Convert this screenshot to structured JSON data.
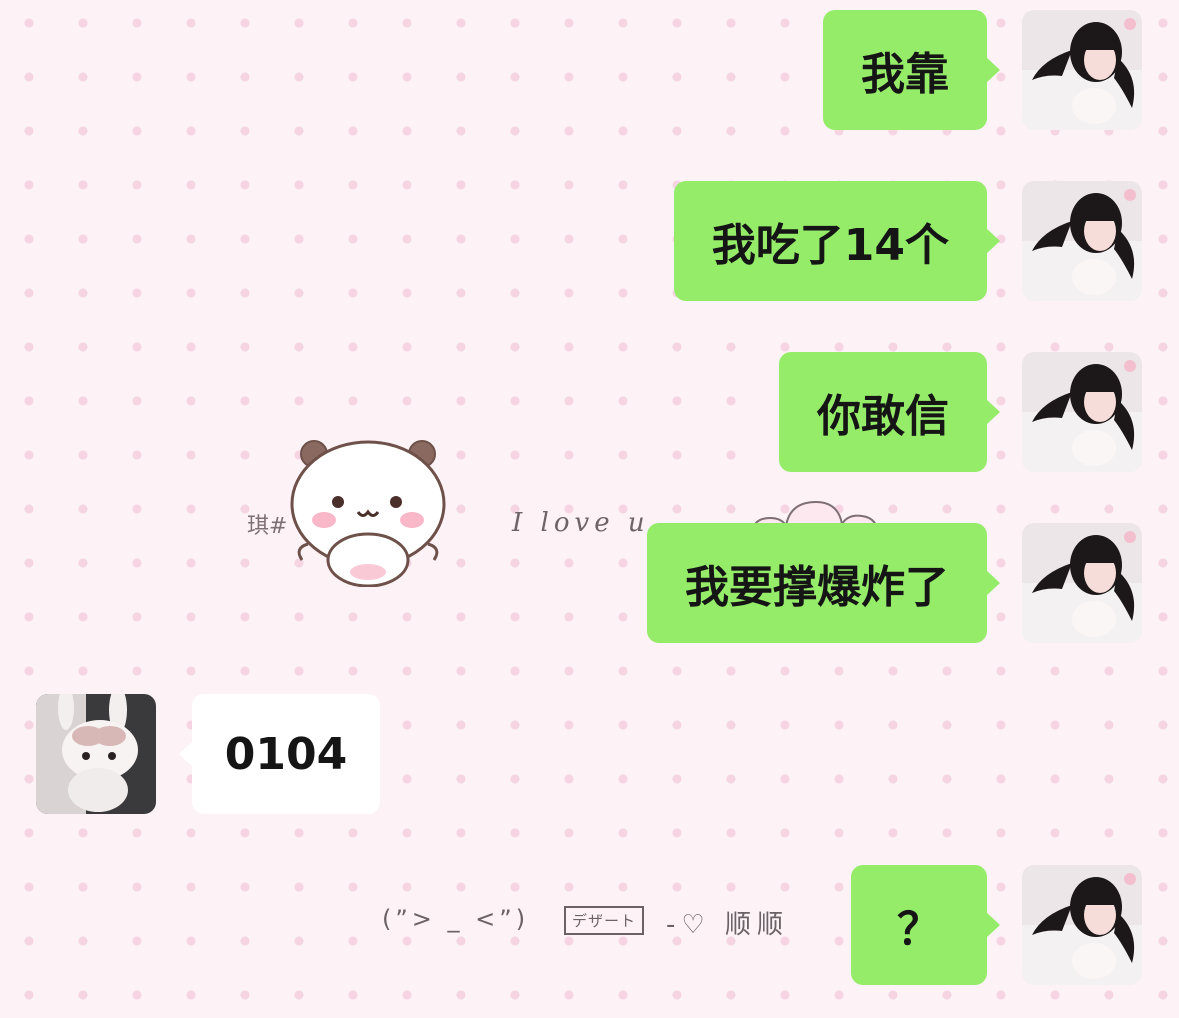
{
  "wallpaper": {
    "left_text": "琪#",
    "love_text": "I love u",
    "face_text": "(”> _ <”)",
    "stamp_text": "デザート",
    "heart_text": "-♡ 顺顺"
  },
  "messages": [
    {
      "side": "out",
      "text": "我靠"
    },
    {
      "side": "out",
      "text": "我吃了14个"
    },
    {
      "side": "out",
      "text": "你敢信"
    },
    {
      "side": "out",
      "text": "我要撑爆炸了"
    },
    {
      "side": "in",
      "text": "0104"
    },
    {
      "side": "out",
      "text": "？"
    }
  ],
  "colors": {
    "outgoing_bubble": "#95ec69",
    "incoming_bubble": "#ffffff",
    "background": "#fdf3f7",
    "dot": "#f6d4e2"
  },
  "avatars": {
    "self": "girl-photo-icon",
    "other": "plush-bunny-icon"
  }
}
